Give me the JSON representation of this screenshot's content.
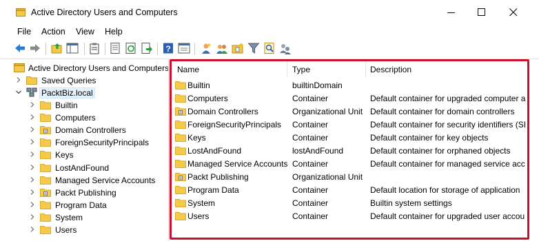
{
  "window": {
    "title": "Active Directory Users and Computers",
    "controls": [
      "minimize-icon",
      "maximize-icon",
      "close-icon"
    ]
  },
  "menu": [
    "File",
    "Action",
    "View",
    "Help"
  ],
  "toolbar": {
    "buttons": [
      "back-icon",
      "forward-icon",
      "up-folder-icon",
      "show-tree-icon",
      "clipboard-icon",
      "properties-icon",
      "refresh-icon",
      "export-list-icon",
      "help-icon",
      "console-icon",
      "new-user-icon",
      "new-group-icon",
      "new-ou-icon",
      "filter-icon",
      "find-icon",
      "add-member-icon"
    ]
  },
  "tree": {
    "root": "Active Directory Users and Computers",
    "saved_queries": "Saved Queries",
    "domain": "PacktBiz.local",
    "children": [
      {
        "label": "Builtin",
        "icon": "folder"
      },
      {
        "label": "Computers",
        "icon": "folder"
      },
      {
        "label": "Domain Controllers",
        "icon": "ou"
      },
      {
        "label": "ForeignSecurityPrincipals",
        "icon": "folder"
      },
      {
        "label": "Keys",
        "icon": "folder"
      },
      {
        "label": "LostAndFound",
        "icon": "folder"
      },
      {
        "label": "Managed Service Accounts",
        "icon": "folder"
      },
      {
        "label": "Packt Publishing",
        "icon": "ou"
      },
      {
        "label": "Program Data",
        "icon": "folder"
      },
      {
        "label": "System",
        "icon": "folder"
      },
      {
        "label": "Users",
        "icon": "folder"
      }
    ]
  },
  "list": {
    "columns": [
      "Name",
      "Type",
      "Description"
    ],
    "rows": [
      {
        "name": "Builtin",
        "type": "builtinDomain",
        "description": "",
        "icon": "folder"
      },
      {
        "name": "Computers",
        "type": "Container",
        "description": "Default container for upgraded computer a",
        "icon": "folder"
      },
      {
        "name": "Domain Controllers",
        "type": "Organizational Unit",
        "description": "Default container for domain controllers",
        "icon": "ou"
      },
      {
        "name": "ForeignSecurityPrincipals",
        "type": "Container",
        "description": "Default container for security identifiers (SI",
        "icon": "folder"
      },
      {
        "name": "Keys",
        "type": "Container",
        "description": "Default container for key objects",
        "icon": "folder"
      },
      {
        "name": "LostAndFound",
        "type": "lostAndFound",
        "description": "Default container for orphaned objects",
        "icon": "folder"
      },
      {
        "name": "Managed Service Accounts",
        "type": "Container",
        "description": "Default container for managed service acc",
        "icon": "folder"
      },
      {
        "name": "Packt Publishing",
        "type": "Organizational Unit",
        "description": "",
        "icon": "ou"
      },
      {
        "name": "Program Data",
        "type": "Container",
        "description": "Default location for storage of application",
        "icon": "folder"
      },
      {
        "name": "System",
        "type": "Container",
        "description": "Builtin system settings",
        "icon": "folder"
      },
      {
        "name": "Users",
        "type": "Container",
        "description": "Default container for upgraded user accou",
        "icon": "folder"
      }
    ]
  },
  "colors": {
    "highlight": "#c8102e",
    "folder": "#f5c94a",
    "folder_dark": "#dcaa2a"
  }
}
